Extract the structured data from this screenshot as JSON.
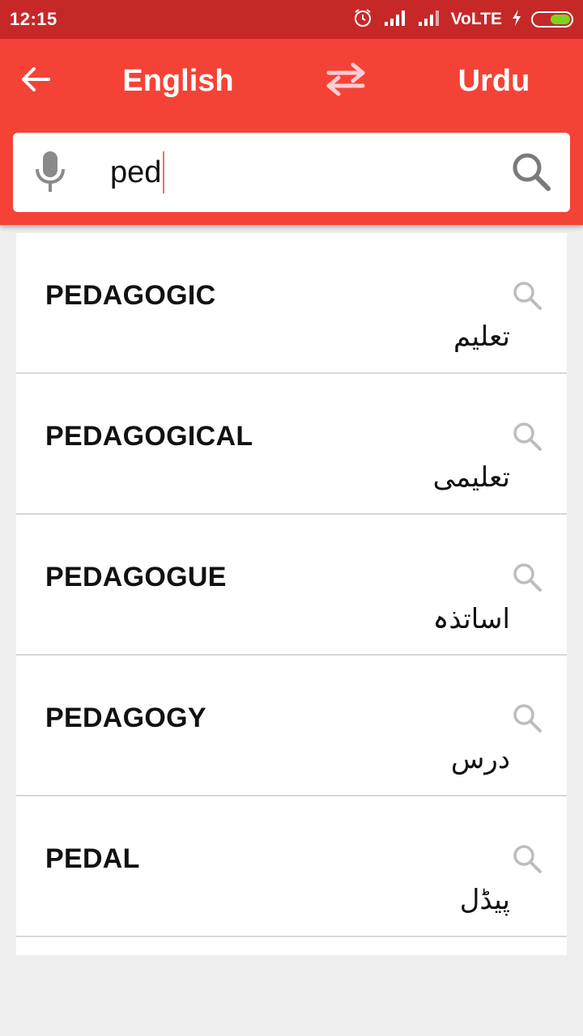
{
  "status_bar": {
    "time": "12:15",
    "network": "VoLTE",
    "colors": {
      "background": "#c62828",
      "battery": "#7ed321"
    },
    "icons": [
      "alarm-icon",
      "signal-icon",
      "signal-icon",
      "charging-icon",
      "battery-icon"
    ]
  },
  "app_bar": {
    "back_icon": "arrow-left-icon",
    "source_language": "English",
    "swap_icon": "swap-horizontal-icon",
    "target_language": "Urdu",
    "color": "#f44336"
  },
  "search": {
    "mic_icon": "microphone-icon",
    "value": "ped",
    "search_icon": "search-icon"
  },
  "results": [
    {
      "word": "PEDAGOGIC",
      "meaning": "تعلیم"
    },
    {
      "word": "PEDAGOGICAL",
      "meaning": "تعلیمی"
    },
    {
      "word": "PEDAGOGUE",
      "meaning": "اساتذہ"
    },
    {
      "word": "PEDAGOGY",
      "meaning": "درس"
    },
    {
      "word": "PEDAL",
      "meaning": "پیڈل"
    }
  ]
}
